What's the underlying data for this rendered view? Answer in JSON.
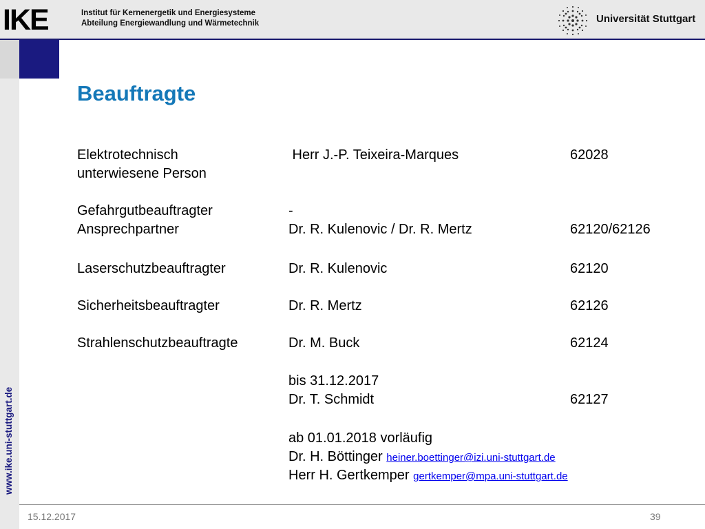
{
  "header": {
    "logo": "IKE",
    "institute_line1": "Institut für Kernenergetik und Energiesysteme",
    "institute_line2": "Abteilung Energiewandlung und Wärmetechnik",
    "university": "Universität Stuttgart"
  },
  "sidebar": {
    "url": "www.ike.uni-stuttgart.de"
  },
  "title": "Beauftragte",
  "rows": {
    "r1": {
      "role_line1": "Elektrotechnisch",
      "role_line2": "unterwiesene Person",
      "name": " Herr J.-P. Teixeira-Marques",
      "phone": "62028"
    },
    "r2": {
      "role": "Gefahrgutbeauftragter",
      "name": "-"
    },
    "r3": {
      "role": "Ansprechpartner",
      "name": "Dr. R. Kulenovic / Dr. R. Mertz",
      "phone": "62120/62126"
    },
    "r4": {
      "role": "Laserschutzbeauftragter",
      "name": "Dr. R. Kulenovic",
      "phone": "62120"
    },
    "r5": {
      "role": "Sicherheitsbeauftragter",
      "name": "Dr. R. Mertz",
      "phone": "62126"
    },
    "r6": {
      "role": "Strahlenschutzbeauftragte",
      "name": "Dr. M. Buck",
      "phone": "62124"
    },
    "r7": {
      "note": "bis 31.12.2017",
      "name": "Dr. T. Schmidt",
      "phone": "62127"
    },
    "r8": {
      "note": "ab 01.01.2018 vorläufig",
      "name1": "Dr. H. Böttinger ",
      "email1": "heiner.boettinger@izi.uni-stuttgart.de",
      "name2": "Herr H. Gertkemper ",
      "email2": "gertkemper@mpa.uni-stuttgart.de"
    }
  },
  "footer": {
    "date": "15.12.2017",
    "page": "39"
  }
}
